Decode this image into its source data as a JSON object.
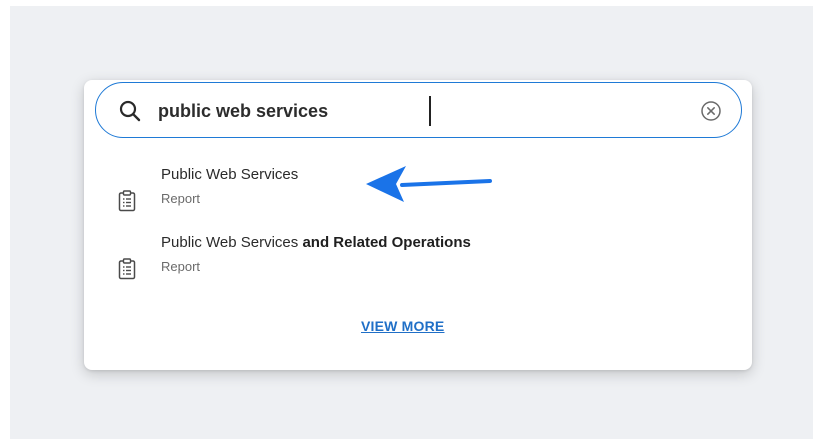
{
  "search": {
    "value": "public web services",
    "placeholder": ""
  },
  "results": [
    {
      "title": "Public Web Services",
      "title_bold": "",
      "type": "Report"
    },
    {
      "title": "Public Web Services",
      "title_bold": " and Related Operations",
      "type": "Report"
    }
  ],
  "footer": {
    "view_more_label": "VIEW MORE"
  },
  "icons": {
    "search": "search-icon",
    "clear": "clear-circle-icon",
    "result": "report-clipboard-icon",
    "annotation": "arrow-left-icon"
  },
  "colors": {
    "accent": "#1f7ad6",
    "link": "#1f6fc7",
    "annotation_arrow": "#1a73e8",
    "backdrop": "#eef0f3"
  }
}
